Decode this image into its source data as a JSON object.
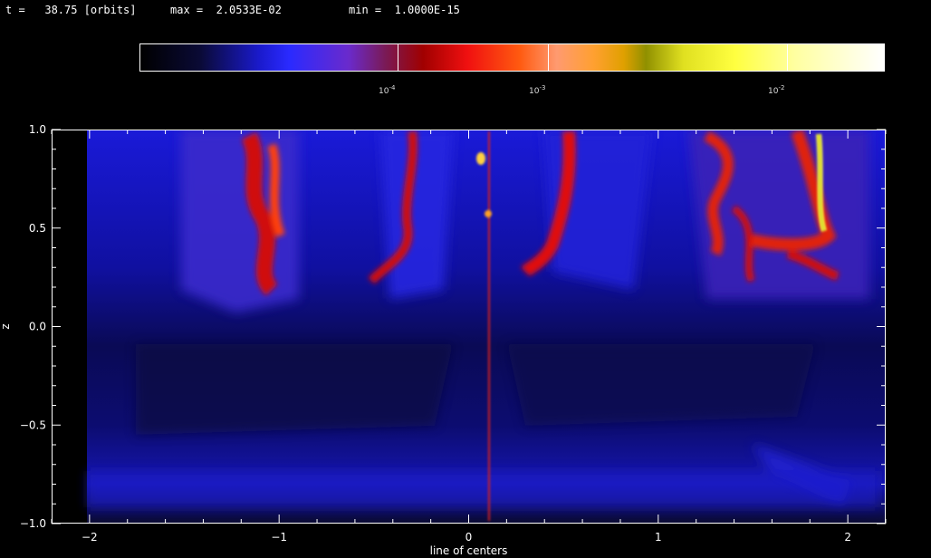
{
  "header": {
    "time_label": "t =   38.75 [orbits]",
    "max_label": "max =  2.0533E-02",
    "min_label": "min =  1.0000E-15"
  },
  "colorbar": {
    "labels": [
      {
        "base": "10",
        "exp": "-4"
      },
      {
        "base": "10",
        "exp": "-3"
      },
      {
        "base": "10",
        "exp": "-2"
      }
    ]
  },
  "chart_data": {
    "type": "heatmap",
    "title": "",
    "xlabel": "line of centers",
    "ylabel": "z",
    "xlim": [
      -2.2,
      2.2
    ],
    "ylim": [
      -1.0,
      1.0
    ],
    "x_ticks": [
      "−2",
      "−1",
      "0",
      "1",
      "2"
    ],
    "y_ticks": [
      "−1.0",
      "−0.5",
      "0.0",
      "0.5",
      "1.0"
    ],
    "colorscale": "log",
    "value_max": 0.020533,
    "value_min": 1e-15,
    "colorbar_ticks": [
      0.0001,
      0.001,
      0.01
    ],
    "colors": {
      "background": "#0a0a40",
      "low": "#1a1acc",
      "mid": "#e01010",
      "high": "#ffff40"
    }
  }
}
